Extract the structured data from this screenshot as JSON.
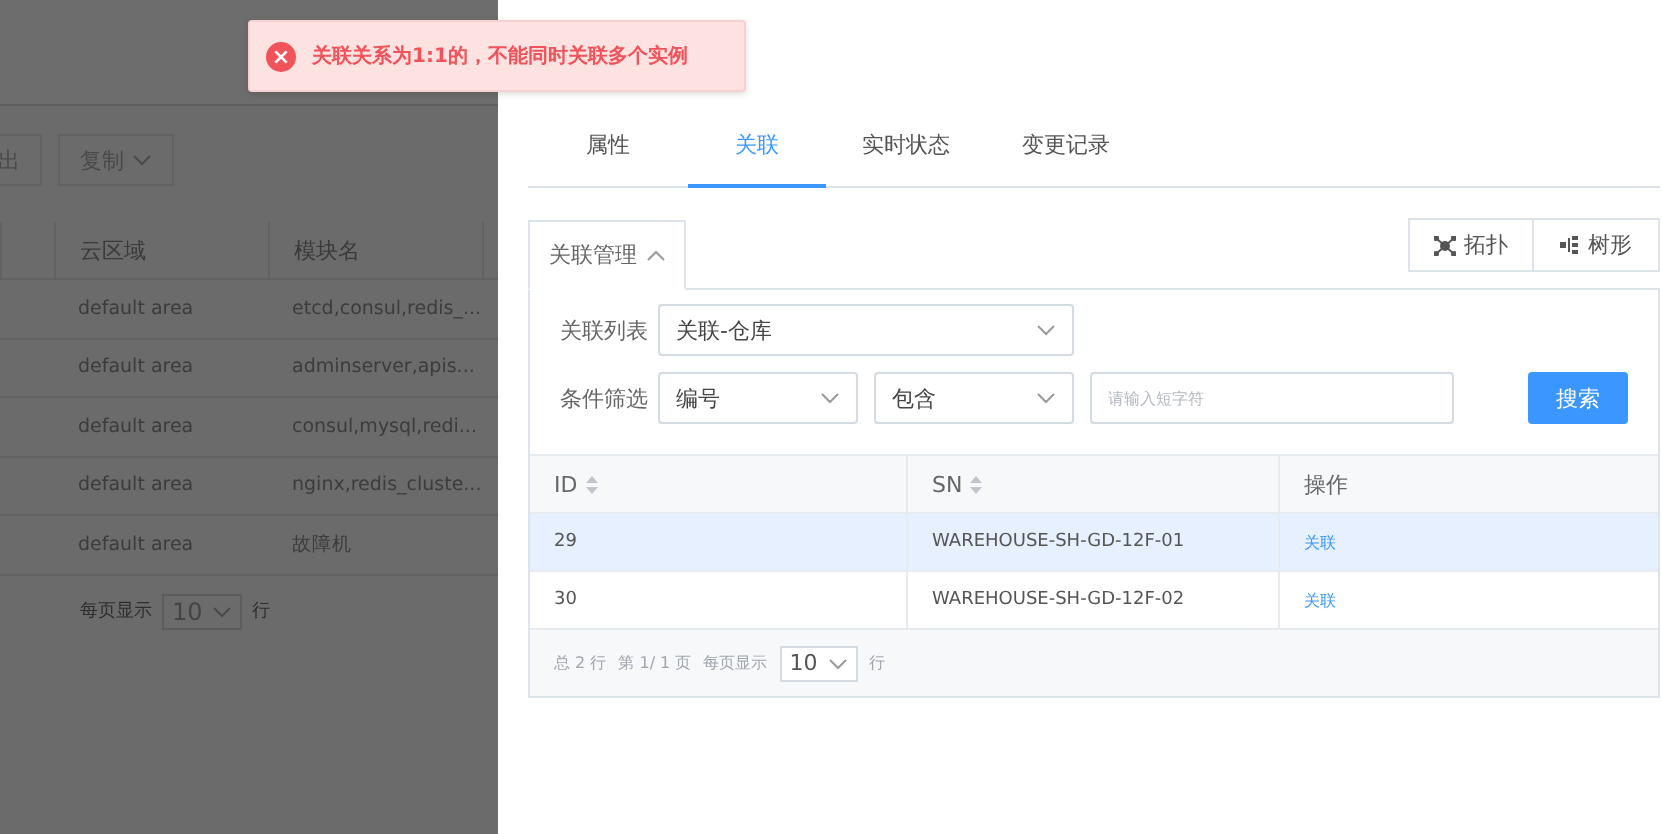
{
  "toast": {
    "kind": "error",
    "message": "关联关系为1:1的，不能同时关联多个实例"
  },
  "background_page": {
    "toolbar": [
      {
        "label": "出",
        "dropdown": false
      },
      {
        "label": "复制",
        "dropdown": true
      }
    ],
    "table": {
      "columns": [
        "",
        "云区域",
        "模块名"
      ],
      "rows": [
        [
          "",
          "default area",
          "etcd,consul,redis_..."
        ],
        [
          "",
          "default area",
          "adminserver,apis..."
        ],
        [
          "",
          "default area",
          "consul,mysql,redi..."
        ],
        [
          "",
          "default area",
          "nginx,redis_cluste..."
        ],
        [
          "",
          "default area",
          "故障机"
        ]
      ]
    },
    "pagination": {
      "per_page_label": "每页显示",
      "per_page": "10",
      "unit": "行"
    }
  },
  "drawer": {
    "tabs": [
      {
        "label": "属性",
        "selected": false
      },
      {
        "label": "关联",
        "selected": true
      },
      {
        "label": "实时状态",
        "selected": false
      },
      {
        "label": "变更记录",
        "selected": false
      }
    ],
    "panel_tab": {
      "label": "关联管理",
      "expanded": true
    },
    "view_buttons": [
      {
        "kind": "topology",
        "label": "拓扑"
      },
      {
        "kind": "tree",
        "label": "树形"
      }
    ],
    "filters": {
      "list_label": "关联列表",
      "list_value": "关联-仓库",
      "condition_label": "条件筛选",
      "field": "编号",
      "operator": "包含",
      "placeholder": "请输入短字符",
      "search_button": "搜索"
    },
    "table": {
      "columns": [
        {
          "label": "ID",
          "sortable": true
        },
        {
          "label": "SN",
          "sortable": true
        },
        {
          "label": "操作",
          "sortable": false
        }
      ],
      "rows": [
        {
          "id": "29",
          "sn": "WAREHOUSE-SH-GD-12F-01",
          "action": "关联",
          "selected": true
        },
        {
          "id": "30",
          "sn": "WAREHOUSE-SH-GD-12F-02",
          "action": "关联",
          "selected": false
        }
      ]
    },
    "pagination": {
      "total": "总 2 行",
      "page": "第 1/ 1 页",
      "per_page_label": "每页显示",
      "per_page": "10",
      "unit": "行"
    }
  }
}
